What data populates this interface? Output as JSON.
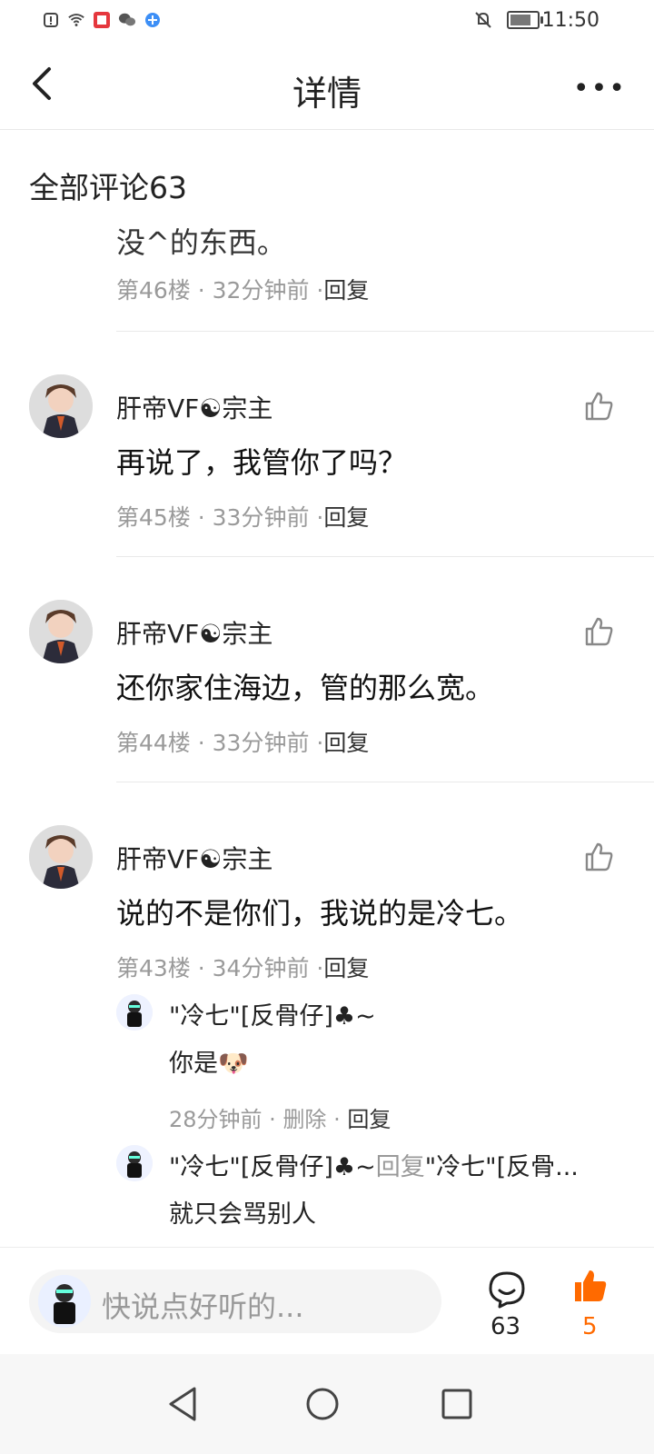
{
  "status_bar": {
    "time": "11:50",
    "icons": [
      "alert-icon",
      "wifi-icon",
      "app-notification-icon",
      "wechat-icon",
      "browser-icon",
      "mute-icon",
      "battery-icon"
    ]
  },
  "header": {
    "title": "详情",
    "more_label": "•••"
  },
  "comments_section": {
    "label": "全部评论63"
  },
  "truncated_comment": {
    "body_fragment": "没^的东西。",
    "meta": {
      "floor": "第46楼",
      "time": "32分钟前",
      "reply": "回复"
    }
  },
  "comments": [
    {
      "user": "肝帝VF☯宗主",
      "body": "再说了，我管你了吗？",
      "meta": {
        "floor": "第45楼",
        "time": "33分钟前",
        "reply": "回复"
      }
    },
    {
      "user": "肝帝VF☯宗主",
      "body": "还你家住海边，管的那么宽。",
      "meta": {
        "floor": "第44楼",
        "time": "33分钟前",
        "reply": "回复"
      }
    },
    {
      "user": "肝帝VF☯宗主",
      "body": "说的不是你们，我说的是冷七。",
      "meta": {
        "floor": "第43楼",
        "time": "34分钟前",
        "reply": "回复"
      }
    }
  ],
  "sub_replies": [
    {
      "user": "\"冷七\"[反骨仔]♣~",
      "body": "你是🐶",
      "meta": {
        "time": "28分钟前",
        "delete": "删除",
        "reply": "回复"
      }
    },
    {
      "user": "\"冷七\"[反骨仔]♣~",
      "reply_word": "回复",
      "reply_to": "\"冷七\"[反骨...",
      "body": "就只会骂别人"
    }
  ],
  "bottom_bar": {
    "input_placeholder": "快说点好听的...",
    "comment_count": "63",
    "like_count": "5",
    "accent": "#ff6a00"
  }
}
